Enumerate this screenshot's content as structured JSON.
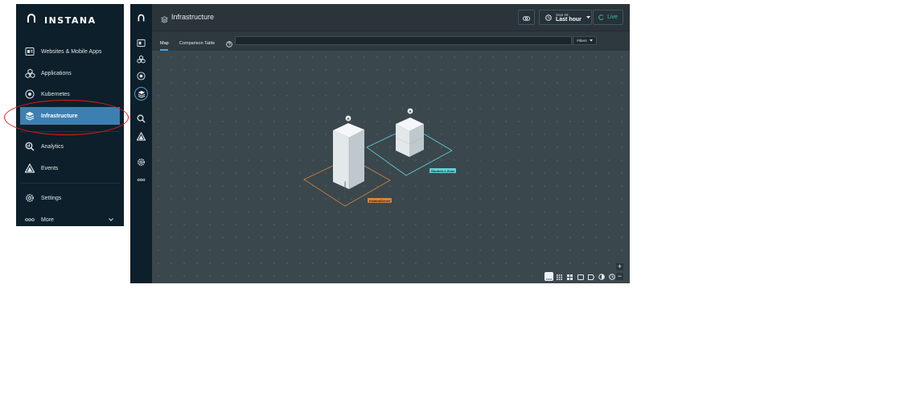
{
  "nav": {
    "brand": "INSTANA",
    "items": [
      {
        "label": "Websites & Mobile Apps",
        "icon": "websites-icon"
      },
      {
        "label": "Applications",
        "icon": "applications-icon"
      },
      {
        "label": "Kubernetes",
        "icon": "kubernetes-icon"
      },
      {
        "label": "Infrastructure",
        "icon": "infrastructure-icon",
        "active": true
      },
      {
        "label": "Analytics",
        "icon": "analytics-icon"
      },
      {
        "label": "Events",
        "icon": "events-icon"
      },
      {
        "label": "Settings",
        "icon": "settings-icon"
      },
      {
        "label": "More",
        "icon": "more-icon"
      }
    ]
  },
  "header": {
    "title": "Infrastructure",
    "time_date": "Sept 28",
    "time_range": "Last hour",
    "live_label": "Live"
  },
  "tabs": [
    {
      "label": "Map",
      "active": true
    },
    {
      "label": "Comparison Table",
      "active": false
    }
  ],
  "toolbar": {
    "search_placeholder": "",
    "filters_label": "Filters"
  },
  "map": {
    "host_1_label": "instanaServer",
    "host_1_side_text": "instanaServer",
    "zone_label": "Student-1-Zone"
  },
  "colors": {
    "accent": "#3d7fb1",
    "live": "#49c38f",
    "zone_1": "#d5843f",
    "zone_2": "#5fd3d4",
    "highlight": "#e11b1b"
  }
}
